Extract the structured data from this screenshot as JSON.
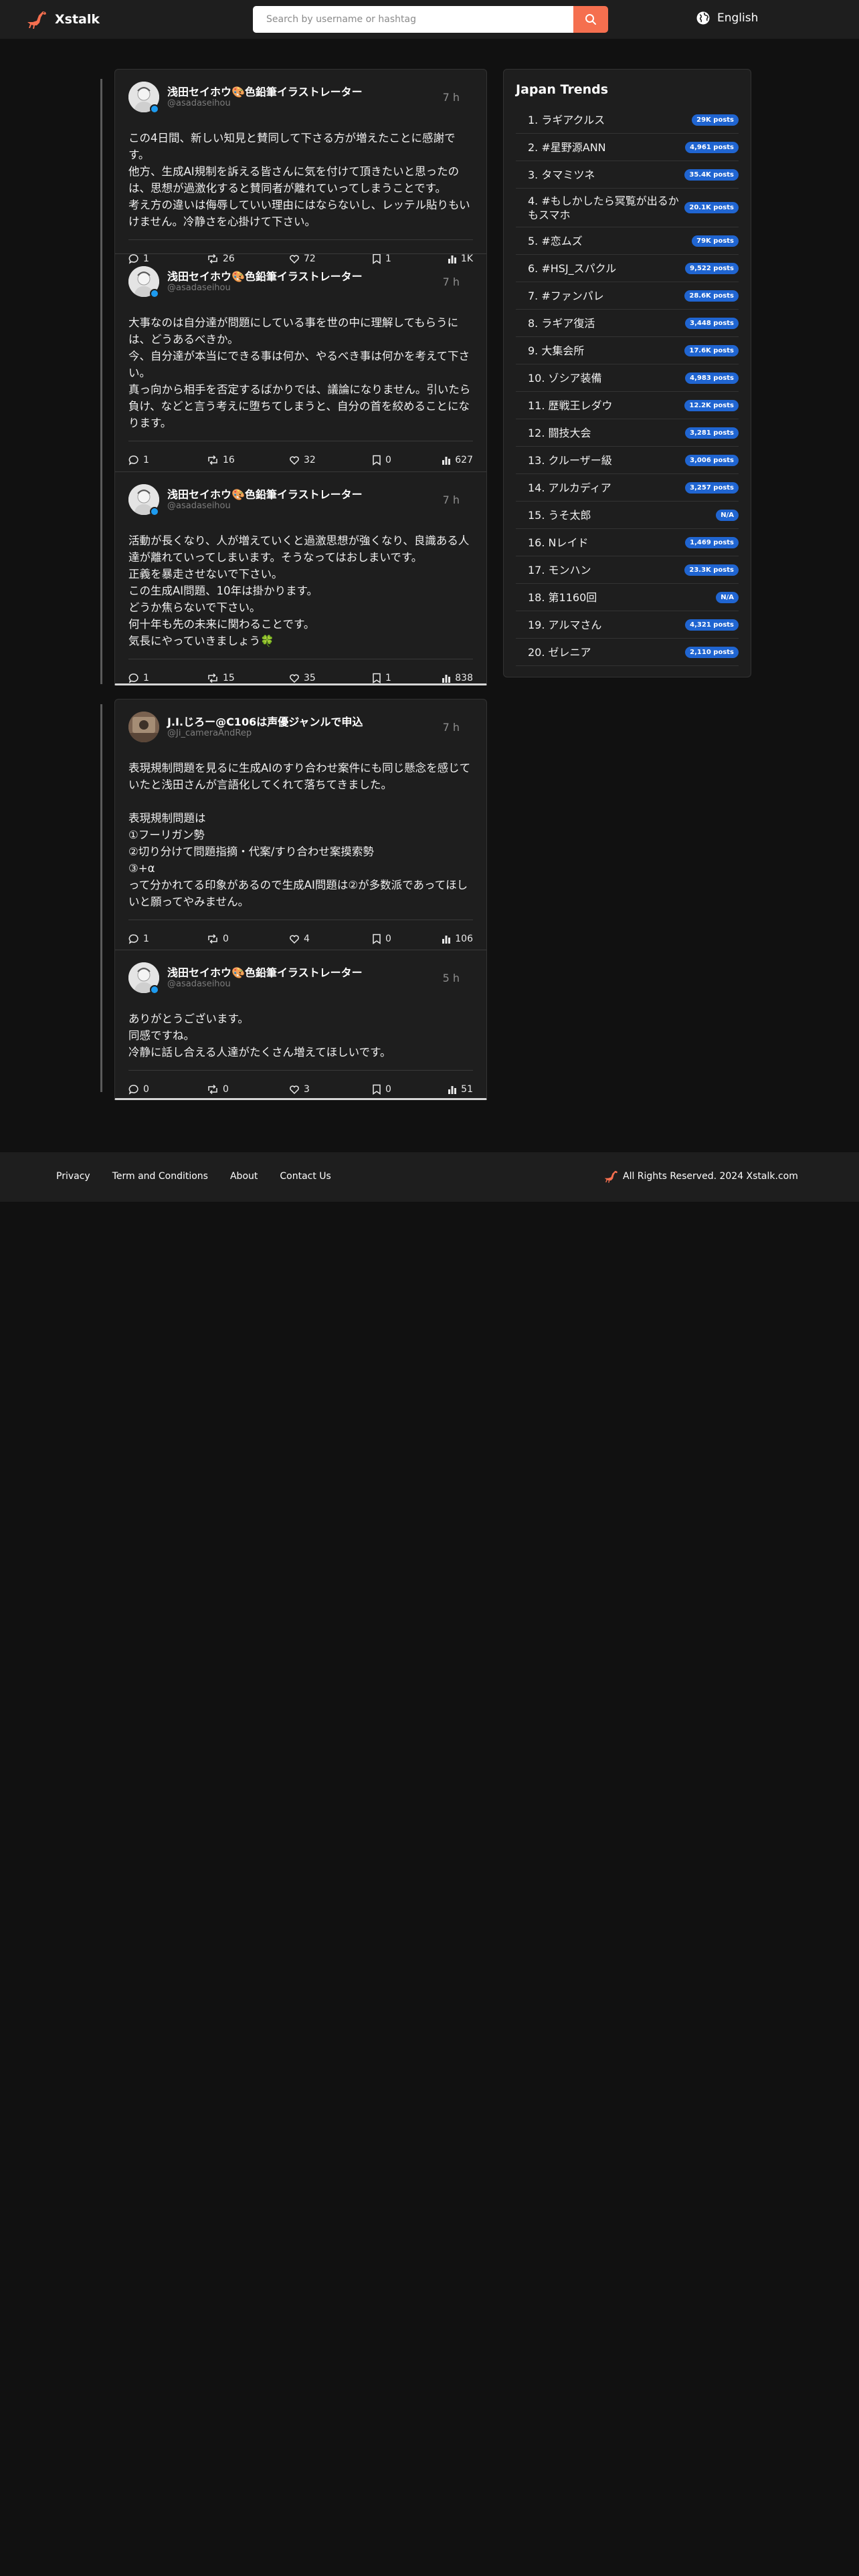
{
  "header": {
    "brand": "Xstalk",
    "search_placeholder": "Search by username or hashtag",
    "language": "English"
  },
  "threads": [
    {
      "posts": [
        {
          "name": "浅田セイホウ🎨色鉛筆イラストレーター",
          "handle": "@asadaseihou",
          "time": "7 h",
          "body": "この4日間、新しい知見と賛同して下さる方が増えたことに感謝です。\n他方、生成AI規制を訴える皆さんに気を付けて頂きたいと思ったのは、思想が過激化すると賛同者が離れていってしまうことです。\n考え方の違いは侮辱していい理由にはならないし、レッテル貼りもいけません。冷静さを心掛けて下さい。",
          "replies": "1",
          "reposts": "26",
          "likes": "72",
          "bookmarks": "1",
          "views": "1K"
        },
        {
          "name": "浅田セイホウ🎨色鉛筆イラストレーター",
          "handle": "@asadaseihou",
          "time": "7 h",
          "body": "大事なのは自分達が問題にしている事を世の中に理解してもらうには、どうあるべきか。\n今、自分達が本当にできる事は何か、やるべき事は何かを考えて下さい。\n真っ向から相手を否定するばかりでは、議論になりません。引いたら負け、などと言う考えに堕ちてしまうと、自分の首を絞めることになります。",
          "replies": "1",
          "reposts": "16",
          "likes": "32",
          "bookmarks": "0",
          "views": "627"
        },
        {
          "name": "浅田セイホウ🎨色鉛筆イラストレーター",
          "handle": "@asadaseihou",
          "time": "7 h",
          "body": "活動が長くなり、人が増えていくと過激思想が強くなり、良識ある人達が離れていってしまいます。そうなってはおしまいです。\n正義を暴走させないで下さい。\nこの生成AI問題、10年は掛かります。\nどうか焦らないで下さい。\n何十年も先の未来に関わることです。\n気長にやっていきましょう🍀",
          "replies": "1",
          "reposts": "15",
          "likes": "35",
          "bookmarks": "1",
          "views": "838"
        }
      ]
    },
    {
      "posts": [
        {
          "name": "J.I.じろー@C106は声優ジャンルで申込",
          "handle": "@Ji_cameraAndRep",
          "time": "7 h",
          "body": "表現規制問題を見るに生成AIのすり合わせ案件にも同じ懸念を感じていたと浅田さんが言語化してくれて落ちてきました。\n\n表現規制問題は\n①フーリガン勢\n②切り分けて問題指摘・代案/すり合わせ案摸索勢\n③+α\nって分かれてる印象があるので生成AI問題は②が多数派であってほしいと願ってやみません。",
          "replies": "1",
          "reposts": "0",
          "likes": "4",
          "bookmarks": "0",
          "views": "106"
        },
        {
          "name": "浅田セイホウ🎨色鉛筆イラストレーター",
          "handle": "@asadaseihou",
          "time": "5 h",
          "body": "ありがとうございます。\n同感ですね。\n冷静に話し合える人達がたくさん増えてほしいです。",
          "replies": "0",
          "reposts": "0",
          "likes": "3",
          "bookmarks": "0",
          "views": "51"
        }
      ]
    }
  ],
  "trends": {
    "title": "Japan Trends",
    "items": [
      {
        "label": "1. ラギアクルス",
        "count": "29K posts"
      },
      {
        "label": "2. #星野源ANN",
        "count": "4,961 posts"
      },
      {
        "label": "3. タマミツネ",
        "count": "35.4K posts"
      },
      {
        "label": "4. #もしかしたら冥覧が出るかもスマホ",
        "count": "20.1K posts"
      },
      {
        "label": "5. #恋ムズ",
        "count": "79K posts"
      },
      {
        "label": "6. #HSJ_スパクル",
        "count": "9,522 posts"
      },
      {
        "label": "7. #ファンパレ",
        "count": "28.6K posts"
      },
      {
        "label": "8. ラギア復活",
        "count": "3,448 posts"
      },
      {
        "label": "9. 大集会所",
        "count": "17.6K posts"
      },
      {
        "label": "10. ゾシア装備",
        "count": "4,983 posts"
      },
      {
        "label": "11. 歴戦王レダウ",
        "count": "12.2K posts"
      },
      {
        "label": "12. 闘技大会",
        "count": "3,281 posts"
      },
      {
        "label": "13. クルーザー級",
        "count": "3,006 posts"
      },
      {
        "label": "14. アルカディア",
        "count": "3,257 posts"
      },
      {
        "label": "15. うそ太郎",
        "count": "N/A"
      },
      {
        "label": "16. Nレイド",
        "count": "1,469 posts"
      },
      {
        "label": "17. モンハン",
        "count": "23.3K posts"
      },
      {
        "label": "18. 第1160回",
        "count": "N/A"
      },
      {
        "label": "19. アルマさん",
        "count": "4,321 posts"
      },
      {
        "label": "20. ゼレニア",
        "count": "2,110 posts"
      }
    ]
  },
  "footer": {
    "links": [
      "Privacy",
      "Term and Conditions",
      "About",
      "Contact Us"
    ],
    "copyright": "All Rights Reserved.  2024 Xstalk.com"
  },
  "colors": {
    "background": "#111111",
    "surface": "#1e1e1e",
    "accent": "#f56f4f",
    "badge": "#2065d1"
  }
}
